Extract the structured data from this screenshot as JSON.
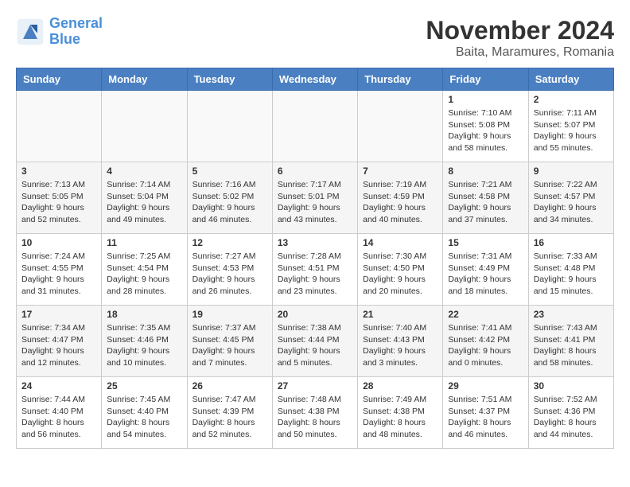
{
  "logo": {
    "line1": "General",
    "line2": "Blue"
  },
  "title": "November 2024",
  "location": "Baita, Maramures, Romania",
  "days_of_week": [
    "Sunday",
    "Monday",
    "Tuesday",
    "Wednesday",
    "Thursday",
    "Friday",
    "Saturday"
  ],
  "weeks": [
    [
      {
        "day": "",
        "info": ""
      },
      {
        "day": "",
        "info": ""
      },
      {
        "day": "",
        "info": ""
      },
      {
        "day": "",
        "info": ""
      },
      {
        "day": "",
        "info": ""
      },
      {
        "day": "1",
        "info": "Sunrise: 7:10 AM\nSunset: 5:08 PM\nDaylight: 9 hours and 58 minutes."
      },
      {
        "day": "2",
        "info": "Sunrise: 7:11 AM\nSunset: 5:07 PM\nDaylight: 9 hours and 55 minutes."
      }
    ],
    [
      {
        "day": "3",
        "info": "Sunrise: 7:13 AM\nSunset: 5:05 PM\nDaylight: 9 hours and 52 minutes."
      },
      {
        "day": "4",
        "info": "Sunrise: 7:14 AM\nSunset: 5:04 PM\nDaylight: 9 hours and 49 minutes."
      },
      {
        "day": "5",
        "info": "Sunrise: 7:16 AM\nSunset: 5:02 PM\nDaylight: 9 hours and 46 minutes."
      },
      {
        "day": "6",
        "info": "Sunrise: 7:17 AM\nSunset: 5:01 PM\nDaylight: 9 hours and 43 minutes."
      },
      {
        "day": "7",
        "info": "Sunrise: 7:19 AM\nSunset: 4:59 PM\nDaylight: 9 hours and 40 minutes."
      },
      {
        "day": "8",
        "info": "Sunrise: 7:21 AM\nSunset: 4:58 PM\nDaylight: 9 hours and 37 minutes."
      },
      {
        "day": "9",
        "info": "Sunrise: 7:22 AM\nSunset: 4:57 PM\nDaylight: 9 hours and 34 minutes."
      }
    ],
    [
      {
        "day": "10",
        "info": "Sunrise: 7:24 AM\nSunset: 4:55 PM\nDaylight: 9 hours and 31 minutes."
      },
      {
        "day": "11",
        "info": "Sunrise: 7:25 AM\nSunset: 4:54 PM\nDaylight: 9 hours and 28 minutes."
      },
      {
        "day": "12",
        "info": "Sunrise: 7:27 AM\nSunset: 4:53 PM\nDaylight: 9 hours and 26 minutes."
      },
      {
        "day": "13",
        "info": "Sunrise: 7:28 AM\nSunset: 4:51 PM\nDaylight: 9 hours and 23 minutes."
      },
      {
        "day": "14",
        "info": "Sunrise: 7:30 AM\nSunset: 4:50 PM\nDaylight: 9 hours and 20 minutes."
      },
      {
        "day": "15",
        "info": "Sunrise: 7:31 AM\nSunset: 4:49 PM\nDaylight: 9 hours and 18 minutes."
      },
      {
        "day": "16",
        "info": "Sunrise: 7:33 AM\nSunset: 4:48 PM\nDaylight: 9 hours and 15 minutes."
      }
    ],
    [
      {
        "day": "17",
        "info": "Sunrise: 7:34 AM\nSunset: 4:47 PM\nDaylight: 9 hours and 12 minutes."
      },
      {
        "day": "18",
        "info": "Sunrise: 7:35 AM\nSunset: 4:46 PM\nDaylight: 9 hours and 10 minutes."
      },
      {
        "day": "19",
        "info": "Sunrise: 7:37 AM\nSunset: 4:45 PM\nDaylight: 9 hours and 7 minutes."
      },
      {
        "day": "20",
        "info": "Sunrise: 7:38 AM\nSunset: 4:44 PM\nDaylight: 9 hours and 5 minutes."
      },
      {
        "day": "21",
        "info": "Sunrise: 7:40 AM\nSunset: 4:43 PM\nDaylight: 9 hours and 3 minutes."
      },
      {
        "day": "22",
        "info": "Sunrise: 7:41 AM\nSunset: 4:42 PM\nDaylight: 9 hours and 0 minutes."
      },
      {
        "day": "23",
        "info": "Sunrise: 7:43 AM\nSunset: 4:41 PM\nDaylight: 8 hours and 58 minutes."
      }
    ],
    [
      {
        "day": "24",
        "info": "Sunrise: 7:44 AM\nSunset: 4:40 PM\nDaylight: 8 hours and 56 minutes."
      },
      {
        "day": "25",
        "info": "Sunrise: 7:45 AM\nSunset: 4:40 PM\nDaylight: 8 hours and 54 minutes."
      },
      {
        "day": "26",
        "info": "Sunrise: 7:47 AM\nSunset: 4:39 PM\nDaylight: 8 hours and 52 minutes."
      },
      {
        "day": "27",
        "info": "Sunrise: 7:48 AM\nSunset: 4:38 PM\nDaylight: 8 hours and 50 minutes."
      },
      {
        "day": "28",
        "info": "Sunrise: 7:49 AM\nSunset: 4:38 PM\nDaylight: 8 hours and 48 minutes."
      },
      {
        "day": "29",
        "info": "Sunrise: 7:51 AM\nSunset: 4:37 PM\nDaylight: 8 hours and 46 minutes."
      },
      {
        "day": "30",
        "info": "Sunrise: 7:52 AM\nSunset: 4:36 PM\nDaylight: 8 hours and 44 minutes."
      }
    ]
  ]
}
